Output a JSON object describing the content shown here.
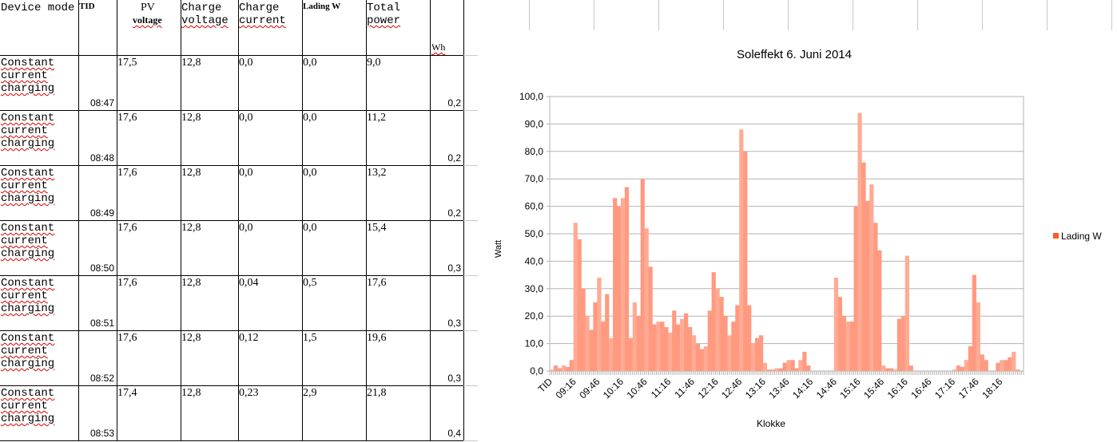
{
  "table": {
    "headers": {
      "device_mode": "Device mode",
      "tid": "TID",
      "pv": "PV",
      "pv2": "voltage",
      "charge_voltage": "Charge",
      "charge_voltage2": "voltage",
      "charge_current": "Charge",
      "charge_current2": "current",
      "lading": "Lading W",
      "total_power": "Total",
      "total_power2": "power",
      "wh": "Wh"
    },
    "rows": [
      {
        "mode1": "Constant",
        "mode2": "current",
        "mode3": "charging",
        "tid": "08:47",
        "pv": "17,5",
        "cv": "12,8",
        "cc": "0,0",
        "lw": "0,0",
        "tp": "9,0",
        "wh": "0,2"
      },
      {
        "mode1": "Constant",
        "mode2": "current",
        "mode3": "charging",
        "tid": "08:48",
        "pv": "17,6",
        "cv": "12,8",
        "cc": "0,0",
        "lw": "0,0",
        "tp": "11,2",
        "wh": "0,2"
      },
      {
        "mode1": "Constant",
        "mode2": "current",
        "mode3": "charging",
        "tid": "08:49",
        "pv": "17,6",
        "cv": "12,8",
        "cc": "0,0",
        "lw": "0,0",
        "tp": "13,2",
        "wh": "0,2"
      },
      {
        "mode1": "Constant",
        "mode2": "current",
        "mode3": "charging",
        "tid": "08:50",
        "pv": "17,6",
        "cv": "12,8",
        "cc": "0,0",
        "lw": "0,0",
        "tp": "15,4",
        "wh": "0,3"
      },
      {
        "mode1": "Constant",
        "mode2": "current",
        "mode3": "charging",
        "tid": "08:51",
        "pv": "17,6",
        "cv": "12,8",
        "cc": "0,04",
        "lw": "0,5",
        "tp": "17,6",
        "wh": "0,3"
      },
      {
        "mode1": "Constant",
        "mode2": "current",
        "mode3": "charging",
        "tid": "08:52",
        "pv": "17,6",
        "cv": "12,8",
        "cc": "0,12",
        "lw": "1,5",
        "tp": "19,6",
        "wh": "0,3"
      },
      {
        "mode1": "Constant",
        "mode2": "current",
        "mode3": "charging",
        "tid": "08:53",
        "pv": "17,4",
        "cv": "12,8",
        "cc": "0,23",
        "lw": "2,9",
        "tp": "21,8",
        "wh": "0,4"
      }
    ]
  },
  "chart_data": {
    "type": "area",
    "title": "Soleffekt 6. Juni 2014",
    "xlabel": "Klokke",
    "ylabel": "Watt",
    "ylim": [
      0,
      100
    ],
    "yticks": [
      "0,0",
      "10,0",
      "20,0",
      "30,0",
      "40,0",
      "50,0",
      "60,0",
      "70,0",
      "80,0",
      "90,0",
      "100,0"
    ],
    "xtick_labels": [
      "TID",
      "09:16",
      "09:46",
      "10:16",
      "10:46",
      "11:16",
      "11:46",
      "12:16",
      "12:46",
      "13:16",
      "13:46",
      "14:16",
      "14:46",
      "15:16",
      "15:46",
      "16:16",
      "16:46",
      "17:16",
      "17:46",
      "18:16"
    ],
    "xtick_step": 6,
    "grid": true,
    "legend": {
      "position": "right",
      "entries": [
        "Lading W"
      ]
    },
    "series": [
      {
        "name": "Lading W",
        "color": "#ff9a80",
        "sample_interval_min": 5,
        "values": [
          0.5,
          2,
          1,
          2,
          1.5,
          4,
          54,
          48,
          30,
          20,
          15,
          25,
          34,
          18,
          28,
          12,
          63,
          60,
          63,
          67,
          12,
          25,
          20,
          70,
          52,
          38,
          17,
          18,
          18,
          16,
          14,
          22,
          17,
          19,
          21,
          16,
          13,
          10,
          8,
          9,
          22,
          36,
          30,
          27,
          20,
          13,
          18,
          24,
          88,
          80,
          24,
          10,
          12,
          13,
          3,
          0.5,
          0.5,
          1,
          1,
          3,
          4,
          4,
          1,
          4,
          7,
          2,
          0,
          0,
          0,
          0,
          0,
          0,
          34,
          27,
          20,
          18,
          18,
          60,
          94,
          76,
          62,
          68,
          54,
          44,
          2,
          1,
          1,
          0.5,
          19,
          20,
          42,
          2,
          0,
          0,
          0,
          0,
          0,
          0,
          0,
          0,
          0,
          0,
          0.5,
          2,
          1.5,
          4,
          9,
          35,
          25,
          6,
          4,
          0,
          0,
          3,
          4,
          4,
          5,
          7,
          0.5,
          0
        ]
      }
    ]
  }
}
